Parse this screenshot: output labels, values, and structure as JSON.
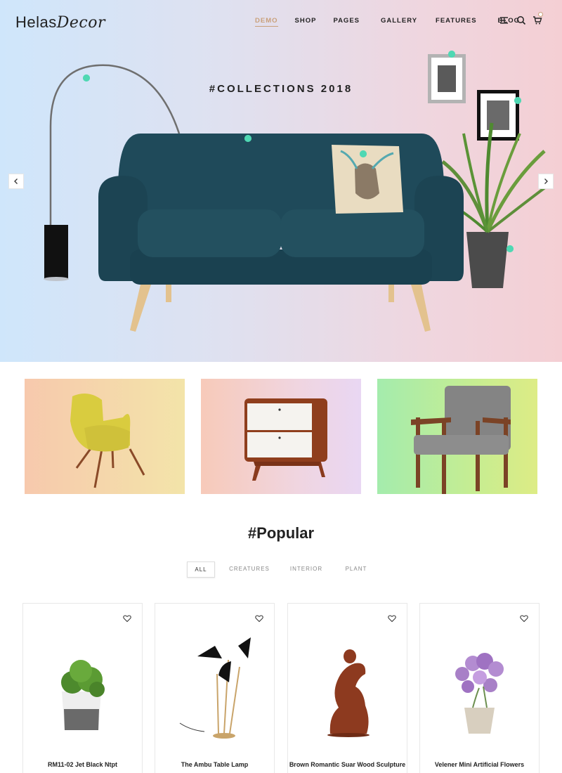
{
  "header": {
    "logo_part1": "Helas",
    "logo_part2": "Decor",
    "nav": [
      "DEMO",
      "SHOP",
      "PAGES",
      "GALLERY",
      "FEATURES",
      "BLOG"
    ],
    "active_nav": "DEMO",
    "icons": [
      "menu-icon",
      "search-icon",
      "cart-icon"
    ]
  },
  "hero": {
    "heading": "#COLLECTIONS 2018",
    "prev_icon": "chevron-left-icon",
    "next_icon": "chevron-right-icon",
    "hotspot_color": "#4fd8b3"
  },
  "banners": [
    {
      "name": "yellow armchair"
    },
    {
      "name": "nightstand"
    },
    {
      "name": "tufted armchair"
    }
  ],
  "popular": {
    "title": "#Popular",
    "filters": [
      "ALL",
      "CREATURES",
      "INTERIOR",
      "PLANT"
    ],
    "active_filter": "ALL",
    "products": [
      {
        "name": "RM11-02 Jet Black Ntpt"
      },
      {
        "name": "The Ambu Table Lamp"
      },
      {
        "name": "Brown Romantic Suar Wood Sculpture"
      },
      {
        "name": "Velener Mini Artificial Flowers"
      }
    ]
  },
  "colors": {
    "accent": "#c9a07a",
    "hotspot": "#4fd8b3",
    "sofa": "#1f4a5a"
  }
}
